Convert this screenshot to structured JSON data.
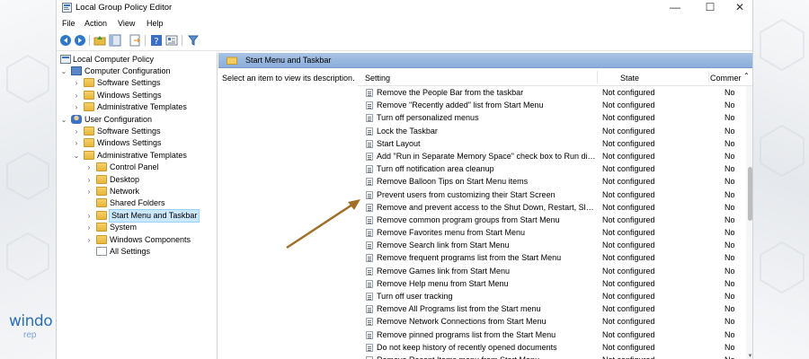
{
  "window": {
    "title": "Local Group Policy Editor",
    "controls": {
      "minimize": "—",
      "maximize": "☐",
      "close": "✕"
    }
  },
  "menu": [
    "File",
    "Action",
    "View",
    "Help"
  ],
  "toolbar": {
    "icons": [
      "back-icon",
      "forward-icon",
      "up-folder-icon",
      "show-hide-tree-icon",
      "export-list-icon",
      "help-icon",
      "properties-icon",
      "filter-icon"
    ]
  },
  "tree": {
    "root": "Local Computer Policy",
    "items": [
      {
        "label": "Computer Configuration",
        "level": 1,
        "state": "expanded",
        "icon": "computer-icon"
      },
      {
        "label": "Software Settings",
        "level": 2,
        "state": "collapsed",
        "icon": "folder-icon"
      },
      {
        "label": "Windows Settings",
        "level": 2,
        "state": "collapsed",
        "icon": "folder-icon"
      },
      {
        "label": "Administrative Templates",
        "level": 2,
        "state": "collapsed",
        "icon": "folder-icon"
      },
      {
        "label": "User Configuration",
        "level": 1,
        "state": "expanded",
        "icon": "user-icon"
      },
      {
        "label": "Software Settings",
        "level": 2,
        "state": "collapsed",
        "icon": "folder-icon"
      },
      {
        "label": "Windows Settings",
        "level": 2,
        "state": "collapsed",
        "icon": "folder-icon"
      },
      {
        "label": "Administrative Templates",
        "level": 2,
        "state": "expanded",
        "icon": "folder-icon"
      },
      {
        "label": "Control Panel",
        "level": 3,
        "state": "collapsed",
        "icon": "folder-icon"
      },
      {
        "label": "Desktop",
        "level": 3,
        "state": "collapsed",
        "icon": "folder-icon"
      },
      {
        "label": "Network",
        "level": 3,
        "state": "collapsed",
        "icon": "folder-icon"
      },
      {
        "label": "Shared Folders",
        "level": 3,
        "state": "none",
        "icon": "folder-icon"
      },
      {
        "label": "Start Menu and Taskbar",
        "level": 3,
        "state": "collapsed",
        "icon": "folder-icon",
        "selected": true
      },
      {
        "label": "System",
        "level": 3,
        "state": "collapsed",
        "icon": "folder-icon"
      },
      {
        "label": "Windows Components",
        "level": 3,
        "state": "collapsed",
        "icon": "folder-icon"
      },
      {
        "label": "All Settings",
        "level": 3,
        "state": "none",
        "icon": "settings-list-icon"
      }
    ]
  },
  "pane": {
    "header": "Start Menu and Taskbar",
    "description": "Select an item to view its description."
  },
  "list": {
    "columns": {
      "setting": "Setting",
      "state": "State",
      "comment": "Commer"
    },
    "rows": [
      {
        "setting": "Remove the People Bar from the taskbar",
        "state": "Not configured",
        "comment": "No"
      },
      {
        "setting": "Remove \"Recently added\" list from Start Menu",
        "state": "Not configured",
        "comment": "No"
      },
      {
        "setting": "Turn off personalized menus",
        "state": "Not configured",
        "comment": "No"
      },
      {
        "setting": "Lock the Taskbar",
        "state": "Not configured",
        "comment": "No"
      },
      {
        "setting": "Start Layout",
        "state": "Not configured",
        "comment": "No"
      },
      {
        "setting": "Add \"Run in Separate Memory Space\" check box to Run dial...",
        "state": "Not configured",
        "comment": "No"
      },
      {
        "setting": "Turn off notification area cleanup",
        "state": "Not configured",
        "comment": "No"
      },
      {
        "setting": "Remove Balloon Tips on Start Menu items",
        "state": "Not configured",
        "comment": "No"
      },
      {
        "setting": "Prevent users from customizing their Start Screen",
        "state": "Not configured",
        "comment": "No"
      },
      {
        "setting": "Remove and prevent access to the Shut Down, Restart, Sleep...",
        "state": "Not configured",
        "comment": "No"
      },
      {
        "setting": "Remove common program groups from Start Menu",
        "state": "Not configured",
        "comment": "No"
      },
      {
        "setting": "Remove Favorites menu from Start Menu",
        "state": "Not configured",
        "comment": "No"
      },
      {
        "setting": "Remove Search link from Start Menu",
        "state": "Not configured",
        "comment": "No"
      },
      {
        "setting": "Remove frequent programs list from the Start Menu",
        "state": "Not configured",
        "comment": "No"
      },
      {
        "setting": "Remove Games link from Start Menu",
        "state": "Not configured",
        "comment": "No"
      },
      {
        "setting": "Remove Help menu from Start Menu",
        "state": "Not configured",
        "comment": "No"
      },
      {
        "setting": "Turn off user tracking",
        "state": "Not configured",
        "comment": "No"
      },
      {
        "setting": "Remove All Programs list from the Start menu",
        "state": "Not configured",
        "comment": "No"
      },
      {
        "setting": "Remove Network Connections from Start Menu",
        "state": "Not configured",
        "comment": "No"
      },
      {
        "setting": "Remove pinned programs list from the Start Menu",
        "state": "Not configured",
        "comment": "No"
      },
      {
        "setting": "Do not keep history of recently opened documents",
        "state": "Not configured",
        "comment": "No"
      },
      {
        "setting": "Remove Recent Items menu from Start Menu",
        "state": "Not configured",
        "comment": "No"
      }
    ]
  },
  "annotation": {
    "arrow_color": "#a0702a",
    "points_to": "Prevent users from customizing their Start Screen"
  },
  "watermark": {
    "text": "windo",
    "sub": "rep"
  }
}
